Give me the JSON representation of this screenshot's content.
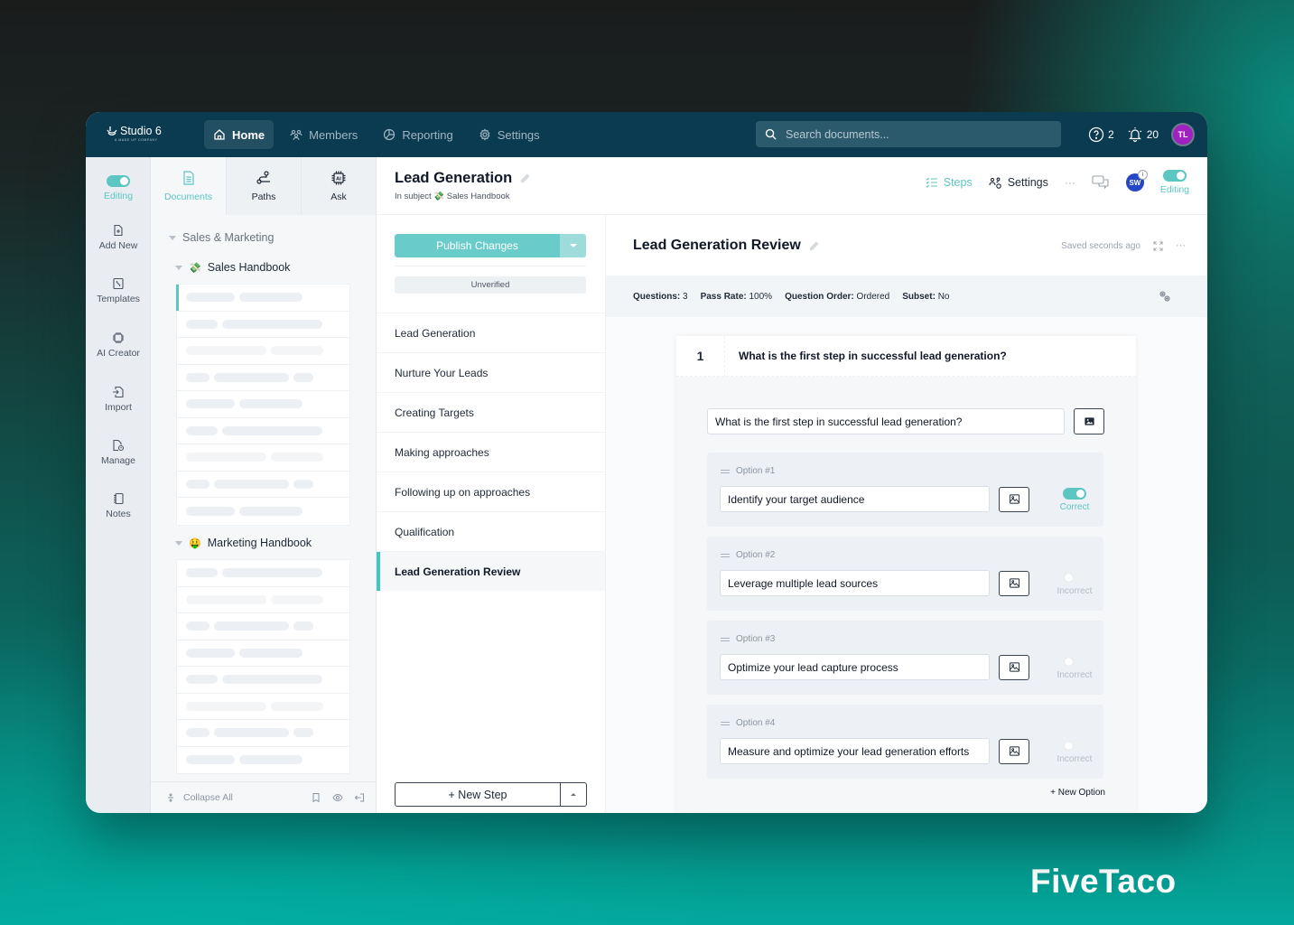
{
  "brand": "FiveTaco",
  "app": {
    "logo": "Studio 6",
    "logo_tagline": "a made up company"
  },
  "topnav": {
    "items": [
      {
        "label": "Home",
        "icon": "home-icon",
        "active": true
      },
      {
        "label": "Members",
        "icon": "members-icon",
        "active": false
      },
      {
        "label": "Reporting",
        "icon": "reporting-icon",
        "active": false
      },
      {
        "label": "Settings",
        "icon": "gear-icon",
        "active": false
      }
    ],
    "search_placeholder": "Search documents...",
    "help_count": "2",
    "notification_count": "20",
    "user_initials": "TL"
  },
  "rail": {
    "editing_label": "Editing",
    "editing_on": true,
    "items": [
      {
        "label": "Add New",
        "icon": "add-file-icon"
      },
      {
        "label": "Templates",
        "icon": "templates-icon"
      },
      {
        "label": "AI Creator",
        "icon": "ai-chip-icon"
      },
      {
        "label": "Import",
        "icon": "import-icon"
      },
      {
        "label": "Manage",
        "icon": "manage-icon"
      },
      {
        "label": "Notes",
        "icon": "notes-icon"
      }
    ]
  },
  "docs_panel": {
    "tabs": [
      {
        "label": "Documents",
        "active": true
      },
      {
        "label": "Paths",
        "active": false
      },
      {
        "label": "Ask",
        "active": false
      }
    ],
    "group": "Sales & Marketing",
    "subjects": [
      {
        "emoji": "💸",
        "label": "Sales Handbook"
      },
      {
        "emoji": "🤑",
        "label": "Marketing Handbook"
      }
    ],
    "footer": {
      "collapse_label": "Collapse All"
    }
  },
  "document": {
    "title": "Lead Generation",
    "subtitle_prefix": "In subject",
    "subject_emoji": "💸",
    "subject": "Sales Handbook",
    "header_actions": {
      "steps_label": "Steps",
      "settings_label": "Settings",
      "collaborator_initials": "SW",
      "editing_label": "Editing"
    }
  },
  "steps_panel": {
    "publish_label": "Publish Changes",
    "status_label": "Unverified",
    "steps": [
      {
        "label": "Lead Generation",
        "active": false
      },
      {
        "label": "Nurture Your Leads",
        "active": false
      },
      {
        "label": "Creating Targets",
        "active": false
      },
      {
        "label": "Making approaches",
        "active": false
      },
      {
        "label": "Following up on approaches",
        "active": false
      },
      {
        "label": "Qualification",
        "active": false
      },
      {
        "label": "Lead Generation Review",
        "active": true
      }
    ],
    "new_step_label": "+ New Step"
  },
  "review": {
    "title": "Lead Generation Review",
    "saved_status": "Saved seconds ago",
    "meta": {
      "questions_label": "Questions:",
      "questions_value": "3",
      "pass_rate_label": "Pass Rate:",
      "pass_rate_value": "100%",
      "order_label": "Question Order:",
      "order_value": "Ordered",
      "subset_label": "Subset:",
      "subset_value": "No"
    },
    "question": {
      "number": "1",
      "heading": "What is the first step in successful lead generation?",
      "input_value": "What is the first step in successful lead generation?",
      "options": [
        {
          "label": "Option #1",
          "value": "Identify your target audience",
          "correct": true,
          "status": "Correct"
        },
        {
          "label": "Option #2",
          "value": "Leverage multiple lead sources",
          "correct": false,
          "status": "Incorrect"
        },
        {
          "label": "Option #3",
          "value": "Optimize your lead capture process",
          "correct": false,
          "status": "Incorrect"
        },
        {
          "label": "Option #4",
          "value": "Measure and optimize your lead generation efforts",
          "correct": false,
          "status": "Incorrect"
        }
      ],
      "new_option_label": "+ New Option"
    }
  },
  "colors": {
    "accent": "#5cc6c3",
    "topbar": "#0b3b50",
    "avatar": "#a021c0",
    "collaborator": "#2546c7"
  }
}
